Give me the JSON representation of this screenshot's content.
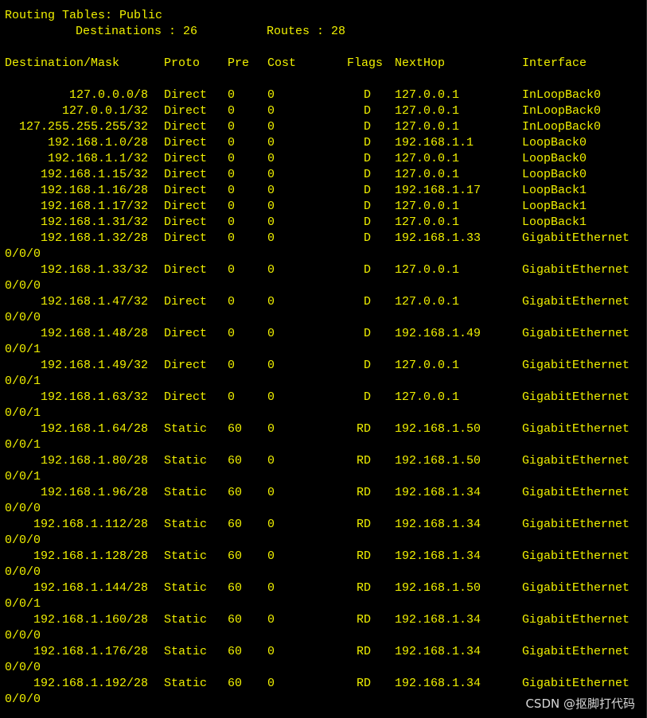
{
  "terminal": {
    "top_rule": "------------------------------------------------------------------------------------------------------------------",
    "title": "Routing Tables: Public",
    "summary": {
      "destinations_label": "Destinations : 26",
      "routes_label": "Routes : 28"
    },
    "columns": {
      "destination": "Destination/Mask",
      "proto": "Proto",
      "pre": "Pre",
      "cost": "Cost",
      "flags": "Flags",
      "nexthop": "NextHop",
      "interface": "Interface"
    },
    "routes": [
      {
        "dest": "127.0.0.0/8",
        "proto": "Direct",
        "pre": "0",
        "cost": "0",
        "flags": "D",
        "nexthop": "127.0.0.1",
        "iface": "InLoopBack0",
        "iface_wrap": ""
      },
      {
        "dest": "127.0.0.1/32",
        "proto": "Direct",
        "pre": "0",
        "cost": "0",
        "flags": "D",
        "nexthop": "127.0.0.1",
        "iface": "InLoopBack0",
        "iface_wrap": ""
      },
      {
        "dest": "127.255.255.255/32",
        "proto": "Direct",
        "pre": "0",
        "cost": "0",
        "flags": "D",
        "nexthop": "127.0.0.1",
        "iface": "InLoopBack0",
        "iface_wrap": ""
      },
      {
        "dest": "192.168.1.0/28",
        "proto": "Direct",
        "pre": "0",
        "cost": "0",
        "flags": "D",
        "nexthop": "192.168.1.1",
        "iface": "LoopBack0",
        "iface_wrap": ""
      },
      {
        "dest": "192.168.1.1/32",
        "proto": "Direct",
        "pre": "0",
        "cost": "0",
        "flags": "D",
        "nexthop": "127.0.0.1",
        "iface": "LoopBack0",
        "iface_wrap": ""
      },
      {
        "dest": "192.168.1.15/32",
        "proto": "Direct",
        "pre": "0",
        "cost": "0",
        "flags": "D",
        "nexthop": "127.0.0.1",
        "iface": "LoopBack0",
        "iface_wrap": ""
      },
      {
        "dest": "192.168.1.16/28",
        "proto": "Direct",
        "pre": "0",
        "cost": "0",
        "flags": "D",
        "nexthop": "192.168.1.17",
        "iface": "LoopBack1",
        "iface_wrap": ""
      },
      {
        "dest": "192.168.1.17/32",
        "proto": "Direct",
        "pre": "0",
        "cost": "0",
        "flags": "D",
        "nexthop": "127.0.0.1",
        "iface": "LoopBack1",
        "iface_wrap": ""
      },
      {
        "dest": "192.168.1.31/32",
        "proto": "Direct",
        "pre": "0",
        "cost": "0",
        "flags": "D",
        "nexthop": "127.0.0.1",
        "iface": "LoopBack1",
        "iface_wrap": ""
      },
      {
        "dest": "192.168.1.32/28",
        "proto": "Direct",
        "pre": "0",
        "cost": "0",
        "flags": "D",
        "nexthop": "192.168.1.33",
        "iface": "GigabitEthernet",
        "iface_wrap": "0/0/0"
      },
      {
        "dest": "192.168.1.33/32",
        "proto": "Direct",
        "pre": "0",
        "cost": "0",
        "flags": "D",
        "nexthop": "127.0.0.1",
        "iface": "GigabitEthernet",
        "iface_wrap": "0/0/0"
      },
      {
        "dest": "192.168.1.47/32",
        "proto": "Direct",
        "pre": "0",
        "cost": "0",
        "flags": "D",
        "nexthop": "127.0.0.1",
        "iface": "GigabitEthernet",
        "iface_wrap": "0/0/0"
      },
      {
        "dest": "192.168.1.48/28",
        "proto": "Direct",
        "pre": "0",
        "cost": "0",
        "flags": "D",
        "nexthop": "192.168.1.49",
        "iface": "GigabitEthernet",
        "iface_wrap": "0/0/1"
      },
      {
        "dest": "192.168.1.49/32",
        "proto": "Direct",
        "pre": "0",
        "cost": "0",
        "flags": "D",
        "nexthop": "127.0.0.1",
        "iface": "GigabitEthernet",
        "iface_wrap": "0/0/1"
      },
      {
        "dest": "192.168.1.63/32",
        "proto": "Direct",
        "pre": "0",
        "cost": "0",
        "flags": "D",
        "nexthop": "127.0.0.1",
        "iface": "GigabitEthernet",
        "iface_wrap": "0/0/1"
      },
      {
        "dest": "192.168.1.64/28",
        "proto": "Static",
        "pre": "60",
        "cost": "0",
        "flags": "RD",
        "nexthop": "192.168.1.50",
        "iface": "GigabitEthernet",
        "iface_wrap": "0/0/1"
      },
      {
        "dest": "192.168.1.80/28",
        "proto": "Static",
        "pre": "60",
        "cost": "0",
        "flags": "RD",
        "nexthop": "192.168.1.50",
        "iface": "GigabitEthernet",
        "iface_wrap": "0/0/1"
      },
      {
        "dest": "192.168.1.96/28",
        "proto": "Static",
        "pre": "60",
        "cost": "0",
        "flags": "RD",
        "nexthop": "192.168.1.34",
        "iface": "GigabitEthernet",
        "iface_wrap": "0/0/0"
      },
      {
        "dest": "192.168.1.112/28",
        "proto": "Static",
        "pre": "60",
        "cost": "0",
        "flags": "RD",
        "nexthop": "192.168.1.34",
        "iface": "GigabitEthernet",
        "iface_wrap": "0/0/0"
      },
      {
        "dest": "192.168.1.128/28",
        "proto": "Static",
        "pre": "60",
        "cost": "0",
        "flags": "RD",
        "nexthop": "192.168.1.34",
        "iface": "GigabitEthernet",
        "iface_wrap": "0/0/0"
      },
      {
        "dest": "192.168.1.144/28",
        "proto": "Static",
        "pre": "60",
        "cost": "0",
        "flags": "RD",
        "nexthop": "192.168.1.50",
        "iface": "GigabitEthernet",
        "iface_wrap": "0/0/1"
      },
      {
        "dest": "192.168.1.160/28",
        "proto": "Static",
        "pre": "60",
        "cost": "0",
        "flags": "RD",
        "nexthop": "192.168.1.34",
        "iface": "GigabitEthernet",
        "iface_wrap": "0/0/0"
      },
      {
        "dest": "192.168.1.176/28",
        "proto": "Static",
        "pre": "60",
        "cost": "0",
        "flags": "RD",
        "nexthop": "192.168.1.34",
        "iface": "GigabitEthernet",
        "iface_wrap": "0/0/0"
      },
      {
        "dest": "192.168.1.192/28",
        "proto": "Static",
        "pre": "60",
        "cost": "0",
        "flags": "RD",
        "nexthop": "192.168.1.34",
        "iface": "GigabitEthernet",
        "iface_wrap": "0/0/0"
      }
    ]
  },
  "watermark": "CSDN @抠脚打代码",
  "colors": {
    "background": "#000000",
    "text": "#f0f000",
    "watermark": "#d8d8d8"
  }
}
